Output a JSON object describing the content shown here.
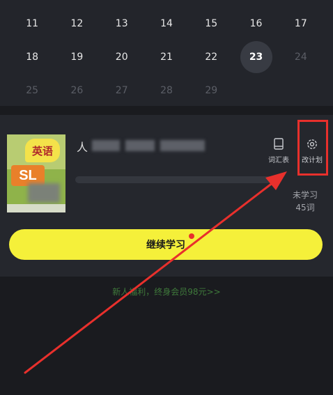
{
  "calendar": {
    "rows": [
      [
        {
          "day": "11",
          "state": "normal"
        },
        {
          "day": "12",
          "state": "normal"
        },
        {
          "day": "13",
          "state": "normal"
        },
        {
          "day": "14",
          "state": "normal"
        },
        {
          "day": "15",
          "state": "normal"
        },
        {
          "day": "16",
          "state": "normal"
        },
        {
          "day": "17",
          "state": "normal"
        }
      ],
      [
        {
          "day": "18",
          "state": "normal"
        },
        {
          "day": "19",
          "state": "normal"
        },
        {
          "day": "20",
          "state": "normal"
        },
        {
          "day": "21",
          "state": "normal"
        },
        {
          "day": "22",
          "state": "normal"
        },
        {
          "day": "23",
          "state": "today"
        },
        {
          "day": "24",
          "state": "dim"
        }
      ],
      [
        {
          "day": "25",
          "state": "dim"
        },
        {
          "day": "26",
          "state": "dim"
        },
        {
          "day": "27",
          "state": "dim"
        },
        {
          "day": "28",
          "state": "dim"
        },
        {
          "day": "29",
          "state": "dim"
        }
      ]
    ]
  },
  "book": {
    "cover_badge": "英语",
    "cover_code": "SL",
    "title_visible_char": "人",
    "progress": 0.0,
    "unlearned_label": "未学习",
    "unlearned_count": "45词"
  },
  "tools": {
    "vocab_label": "词汇表",
    "plan_label": "改计划"
  },
  "actions": {
    "continue_label": "继续学习"
  },
  "promo": {
    "text": "新人福利，终身会员98元>>"
  },
  "colors": {
    "accent_yellow": "#f5f03a",
    "highlight_red": "#e8302c",
    "promo_green": "#3f7a3b"
  }
}
